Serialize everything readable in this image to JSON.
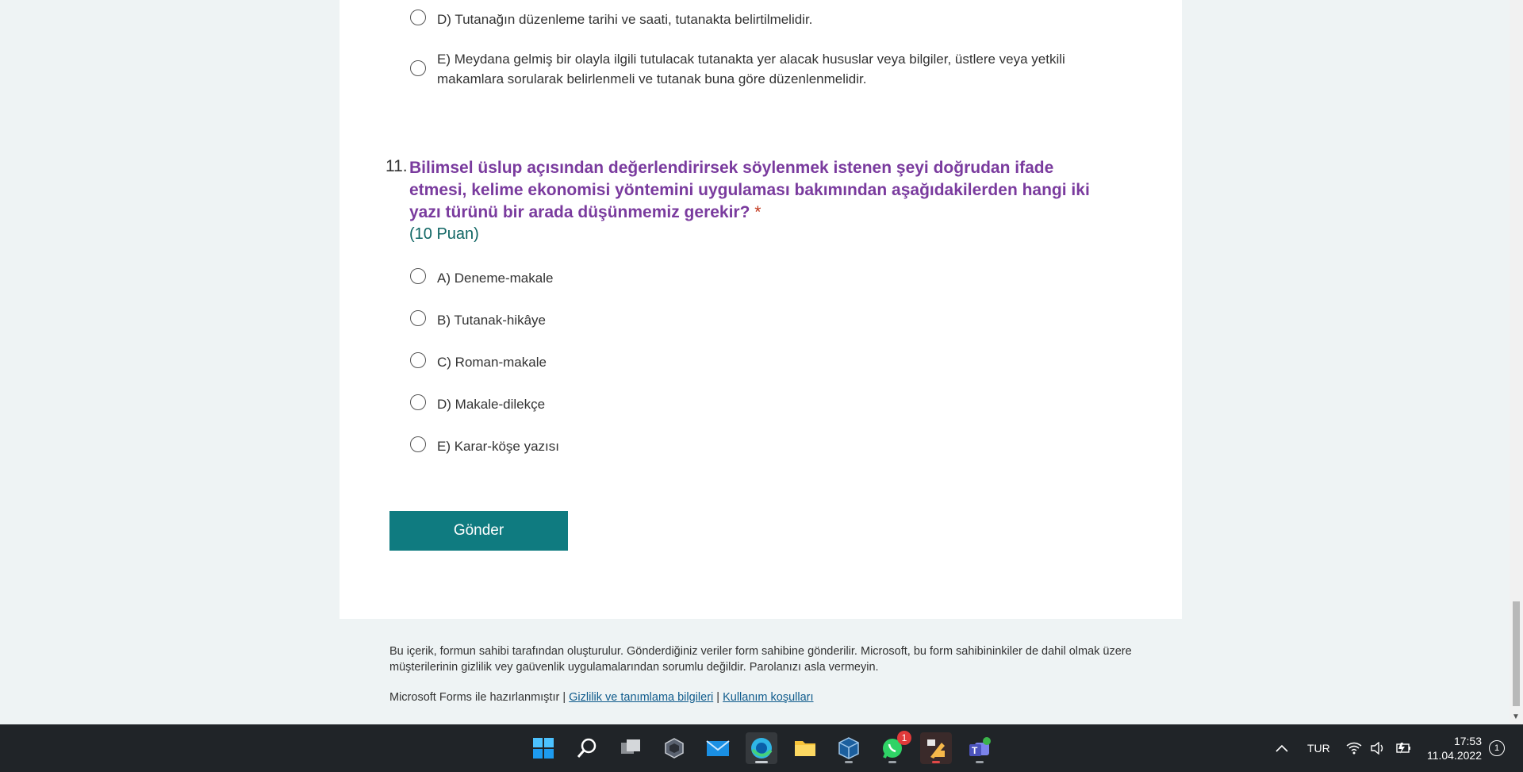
{
  "prev_question": {
    "options": [
      "D) Tutanağın düzenleme tarihi ve saati, tutanakta belirtilmelidir.",
      "E) Meydana gelmiş bir olayla ilgili tutulacak tutanakta yer alacak hususlar veya bilgiler, üstlere veya yetkili makamlara sorularak belirlenmeli ve tutanak buna göre düzenlenmelidir."
    ]
  },
  "question": {
    "number": "11.",
    "title": "Bilimsel üslup açısından değerlendirirsek söylenmek istenen şeyi doğrudan ifade etmesi, kelime ekonomisi yöntemini uygulaması bakımından aşağıdakilerden hangi iki yazı türünü bir arada düşünmemiz gerekir?",
    "required_mark": "*",
    "points": "(10 Puan)",
    "options": [
      "A) Deneme-makale",
      "B) Tutanak-hikâye",
      "C) Roman-makale",
      "D) Makale-dilekçe",
      "E) Karar-köşe yazısı"
    ]
  },
  "submit_label": "Gönder",
  "footer": {
    "disclaimer": "Bu içerik, formun sahibi tarafından oluşturulur. Gönderdiğiniz veriler form sahibine gönderilir. Microsoft, bu form sahibininkiler de dahil olmak üzere müşterilerinin gizlilik vey gaüvenlik uygulamalarından sorumlu değildir. Parolanızı asla vermeyin.",
    "made_with": "Microsoft Forms ile hazırlanmıştır |",
    "privacy_link": "Gizlilik ve tanımlama bilgileri",
    "separator": "|",
    "terms_link": "Kullanım koşulları"
  },
  "taskbar": {
    "whatsapp_badge": "1",
    "language": "TUR",
    "time": "17:53",
    "date": "11.04.2022",
    "notification_count": "1"
  },
  "colors": {
    "accent": "#0f7b80",
    "question_title": "#7a3b9e",
    "points": "#106664",
    "required": "#c2361c"
  }
}
